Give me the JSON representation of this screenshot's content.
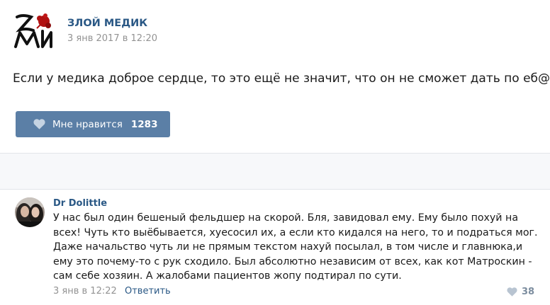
{
  "post": {
    "group_name": "ЗЛОЙ МЕДИК",
    "date": "3 янв 2017 в 12:20",
    "text": "Если у медика доброе сердце, то это ещё не значит, что он не сможет дать по еб@лу.",
    "like_label": "Мне нравится",
    "like_count": "1283",
    "logo_icon": "zm-logo-icon"
  },
  "comment": {
    "author": "Dr Dolittle",
    "lines": [
      "У нас был один бешеный фельдшер на скорой. Бля, завидовал ему. Ему было похуй на",
      "всех! Чуть кто выёбывается, хуесосил их, а если кто кидался на него, то и подраться мог.",
      "Даже начальство чуть ли не прямым текстом нахуй посылал, в том числе и главнюка,и",
      "ему это почему-то с рук сходило. Был абсолютно независим от всех, как кот Матроскин -",
      "сам себе хозяин. А жалобами пациентов жопу подтирал по сути."
    ],
    "date": "3 янв в 12:22",
    "reply_label": "Ответить",
    "like_count": "38"
  },
  "colors": {
    "link": "#2a5885",
    "like_button": "#5b7fa6",
    "muted": "#939393",
    "logo_red": "#b11212"
  }
}
